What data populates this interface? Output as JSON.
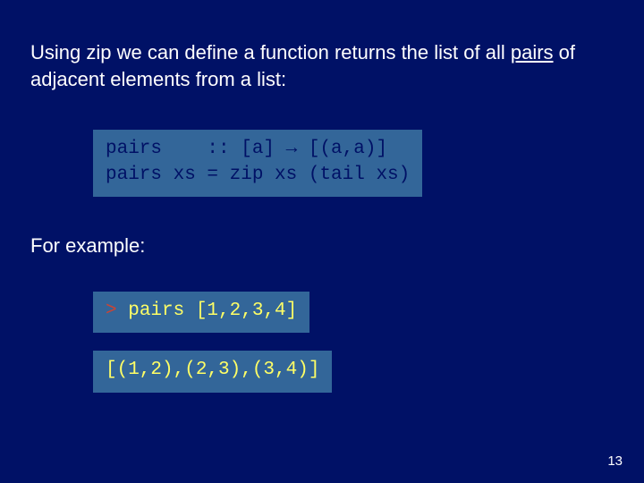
{
  "intro": {
    "part1": "Using zip we can define a function returns the list of all ",
    "pairs_word": "pairs",
    "part2": " of adjacent elements from a list:"
  },
  "code1": {
    "line1": "pairs    :: [a] → [(a,a)]",
    "line2": "pairs xs = zip xs (tail xs)"
  },
  "for_example": "For example:",
  "code2": {
    "prompt": ">",
    "call": " pairs [1,2,3,4]"
  },
  "code3": {
    "result": "[(1,2),(2,3),(3,4)]"
  },
  "page_number": "13"
}
